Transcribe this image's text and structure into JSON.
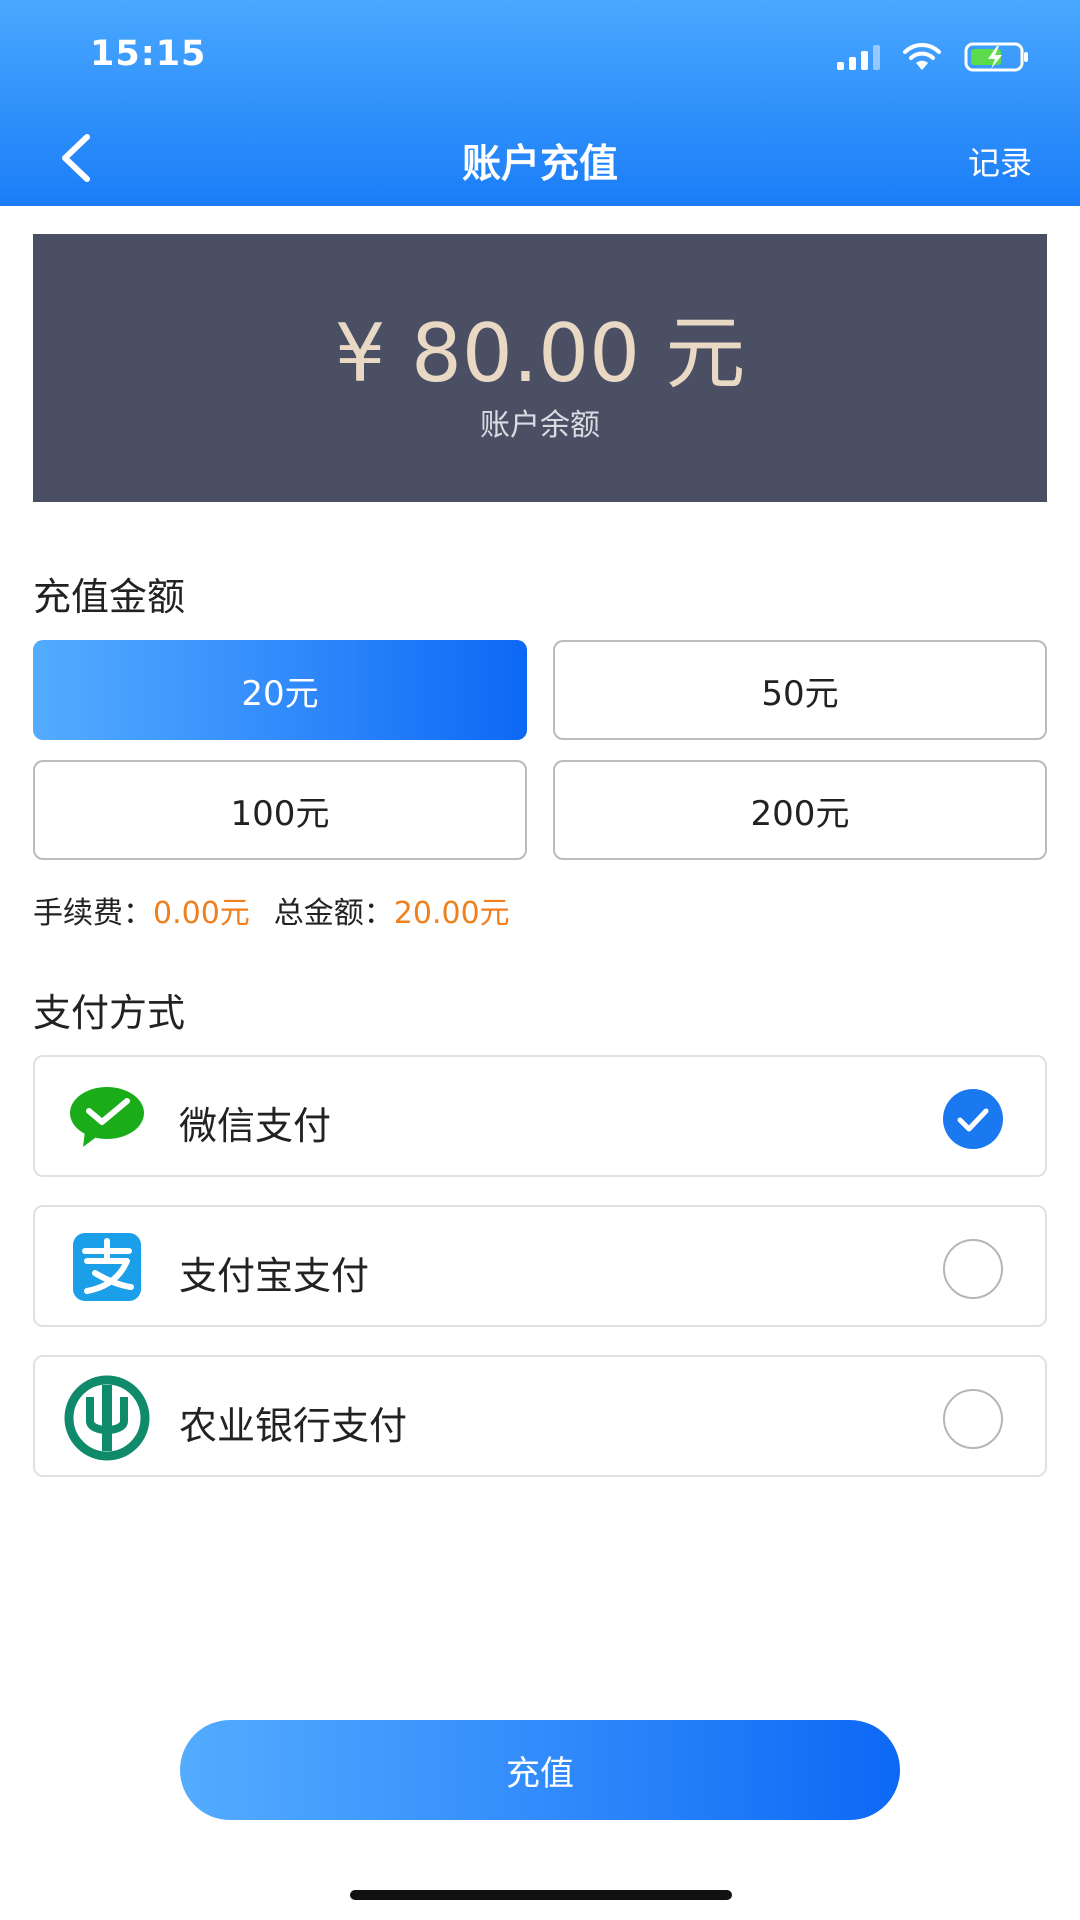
{
  "status_bar": {
    "time": "15:15"
  },
  "nav": {
    "title": "账户充值",
    "record": "记录"
  },
  "balance": {
    "value": "¥ 80.00 元",
    "label": "账户余额"
  },
  "amount_section": {
    "title": "充值金额",
    "options": [
      "20元",
      "50元",
      "100元",
      "200元"
    ],
    "selected_index": 0
  },
  "fee": {
    "fee_label": "手续费：",
    "fee_value": "0.00元",
    "total_label": "总金额：",
    "total_value": "20.00元"
  },
  "payment_section": {
    "title": "支付方式",
    "methods": [
      {
        "label": "微信支付",
        "icon": "wechat-pay-icon",
        "selected": true
      },
      {
        "label": "支付宝支付",
        "icon": "alipay-icon",
        "selected": false
      },
      {
        "label": "农业银行支付",
        "icon": "abc-bank-icon",
        "selected": false
      }
    ]
  },
  "submit": {
    "label": "充值"
  },
  "colors": {
    "primary": "#1a7df7",
    "accent": "#f07f1e",
    "card": "#4b4f63",
    "wechat": "#1aad19",
    "alipay": "#1a9fe8",
    "abc": "#0f8a6a"
  }
}
